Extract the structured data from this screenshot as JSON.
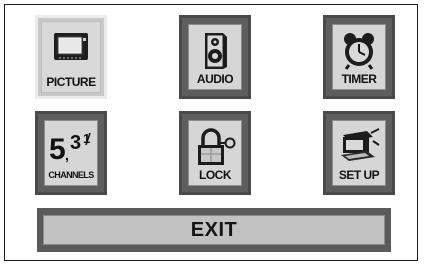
{
  "menu": {
    "items": [
      {
        "label": "PICTURE",
        "icon": "tv-screen-icon",
        "selected": true
      },
      {
        "label": "AUDIO",
        "icon": "speaker-icon",
        "selected": false
      },
      {
        "label": "TIMER",
        "icon": "alarm-clock-icon",
        "selected": false
      },
      {
        "label": "CHANNELS",
        "icon": "channel-numbers-icon",
        "glyph": "5,3",
        "selected": false
      },
      {
        "label": "LOCK",
        "icon": "padlock-key-icon",
        "selected": false
      },
      {
        "label": "SET UP",
        "icon": "setup-device-icon",
        "selected": false
      }
    ],
    "exit_label": "EXIT"
  }
}
